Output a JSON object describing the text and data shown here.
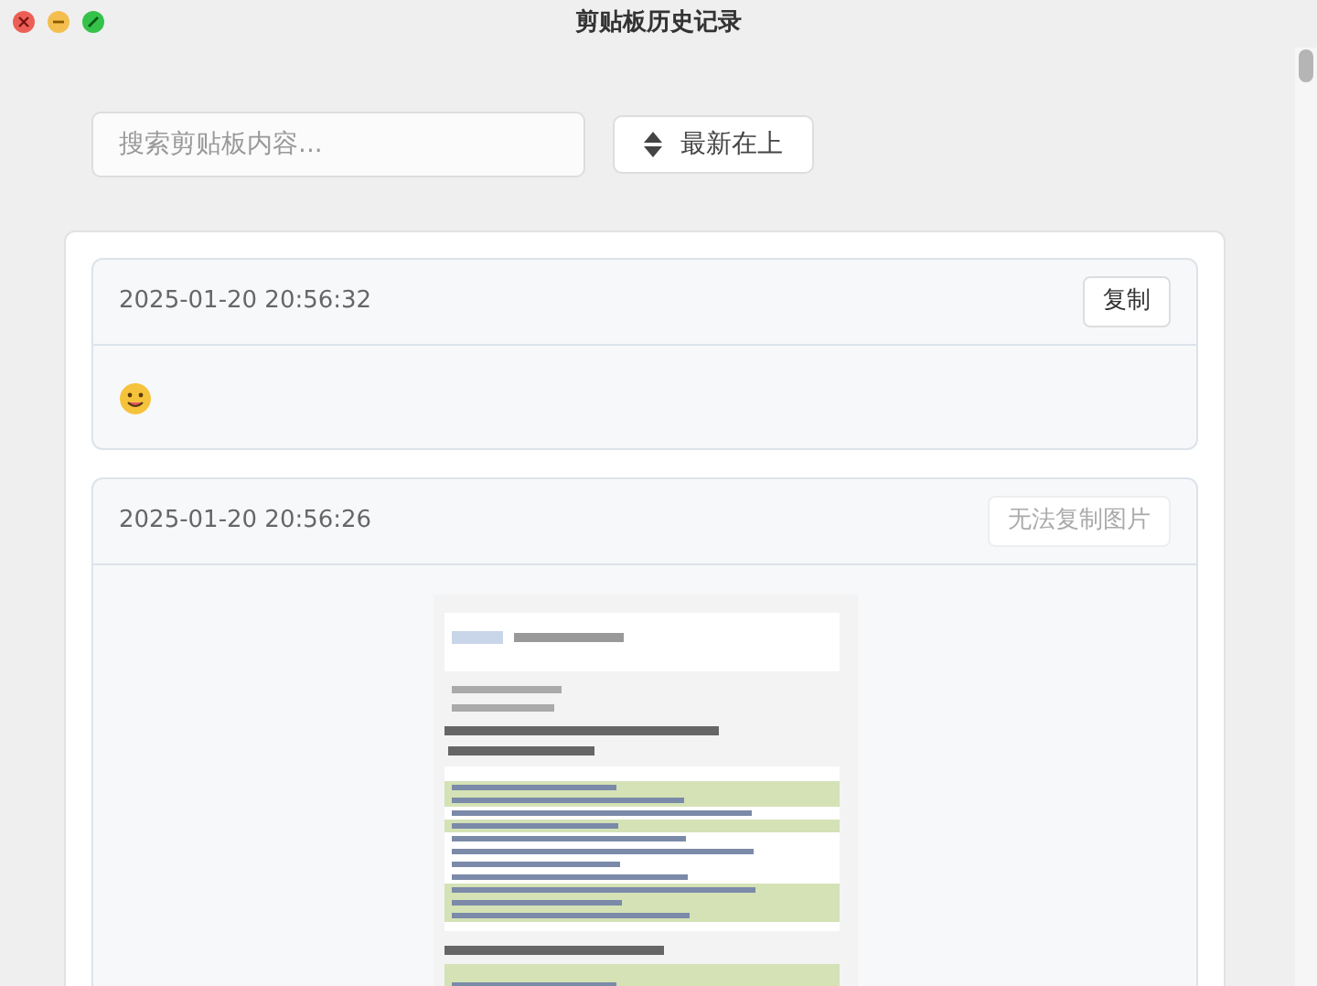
{
  "window": {
    "title": "剪贴板历史记录"
  },
  "search": {
    "placeholder": "搜索剪贴板内容..."
  },
  "sort_button": {
    "label": "最新在上"
  },
  "items": [
    {
      "kind": "emoji",
      "time": "2025-01-20 20:56:32",
      "copy_button": {
        "label": "复制",
        "disabled": false
      }
    },
    {
      "kind": "image",
      "time": "2025-01-20 20:56:26",
      "copy_button": {
        "label": "无法复制图片",
        "disabled": true
      }
    }
  ]
}
